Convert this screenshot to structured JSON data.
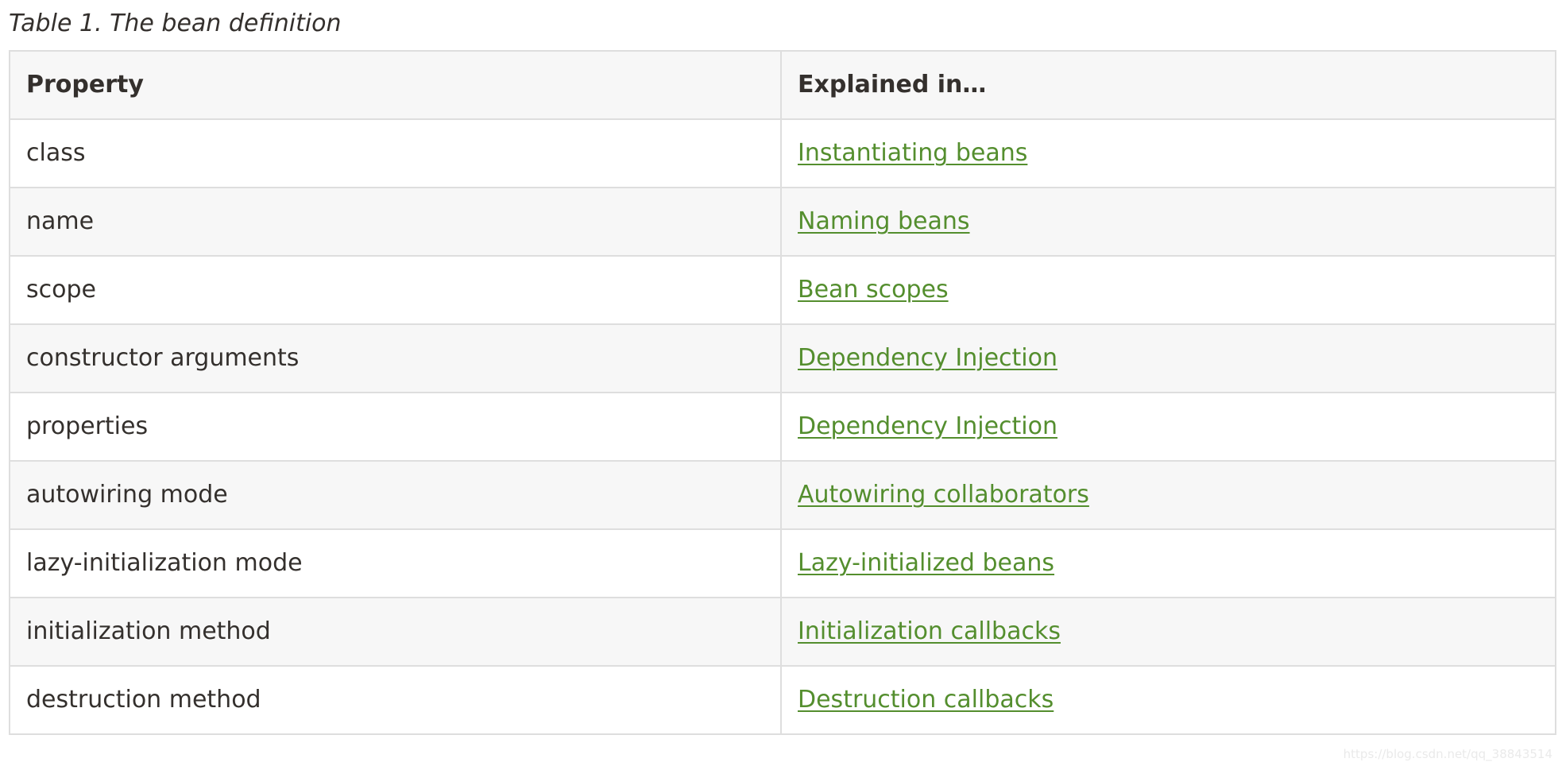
{
  "caption": "Table 1. The bean definition",
  "table": {
    "headers": [
      "Property",
      "Explained in…"
    ],
    "rows": [
      {
        "property": "class",
        "link": "Instantiating beans"
      },
      {
        "property": "name",
        "link": "Naming beans"
      },
      {
        "property": "scope",
        "link": "Bean scopes"
      },
      {
        "property": "constructor arguments",
        "link": "Dependency Injection"
      },
      {
        "property": "properties",
        "link": "Dependency Injection"
      },
      {
        "property": "autowiring mode",
        "link": "Autowiring collaborators"
      },
      {
        "property": "lazy-initialization mode",
        "link": "Lazy-initialized beans"
      },
      {
        "property": "initialization method",
        "link": "Initialization callbacks"
      },
      {
        "property": "destruction method",
        "link": "Destruction callbacks"
      }
    ]
  },
  "watermark": "https://blog.csdn.net/qq_38843514",
  "colors": {
    "link": "#548e2e",
    "text": "#34302d",
    "stripe": "#f7f7f7",
    "border": "#dedede"
  }
}
